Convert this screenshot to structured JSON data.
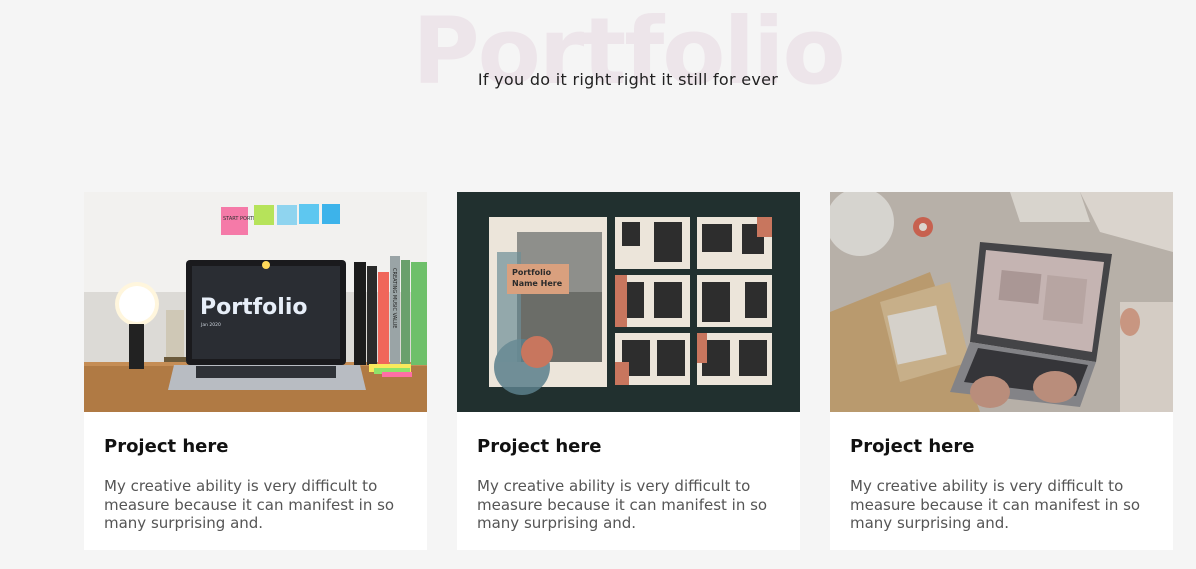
{
  "section": {
    "background_title": "Portfolio",
    "subtitle": "If you do it right right it still for ever"
  },
  "cards": [
    {
      "title": "Project here",
      "text": "My creative ability is very difficult to measure because it can manifest in so many surprising and.",
      "image": {
        "laptop_screen_title": "Portfolio",
        "laptop_screen_sub": "Jan 2020",
        "sticky_note": "START PORTFOLIO",
        "book_spine": "CREATING MUSIC VALUE"
      }
    },
    {
      "title": "Project here",
      "text": "My creative ability is very difficult to measure because it can manifest in so many surprising and.",
      "image": {
        "label_line1": "Portfolio",
        "label_line2": "Name Here"
      }
    },
    {
      "title": "Project here",
      "text": "My creative ability is very difficult to measure because it can manifest in so many surprising and.",
      "image": {}
    }
  ]
}
